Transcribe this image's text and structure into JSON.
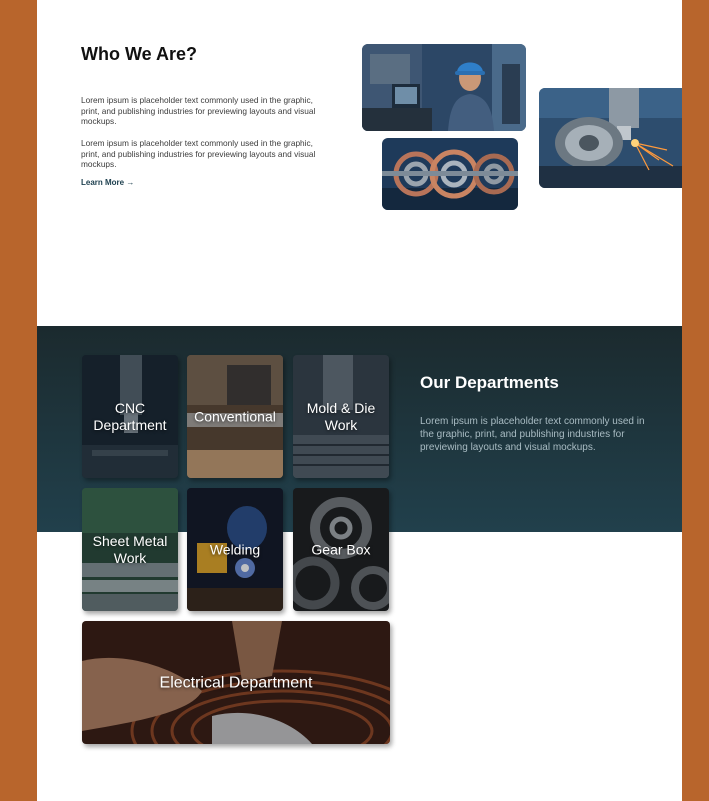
{
  "about": {
    "title": "Who We Are?",
    "paragraph_1": "Lorem ipsum is placeholder text commonly used in the graphic, print, and publishing industries for previewing layouts and visual mockups.",
    "paragraph_2": "Lorem ipsum is placeholder text commonly used in the graphic, print, and publishing industries for previewing layouts and visual mockups.",
    "learn_more": "Learn More →"
  },
  "departments": {
    "title": "Our Departments",
    "description": "Lorem ipsum is placeholder text commonly used in the graphic, print, and publishing industries for previewing layouts and visual mockups.",
    "cards": [
      {
        "label": "CNC Department"
      },
      {
        "label": "Conventional"
      },
      {
        "label": "Mold & Die Work"
      },
      {
        "label": "Sheet Metal Work"
      },
      {
        "label": "Welding"
      },
      {
        "label": "Gear Box"
      },
      {
        "label": "Electrical Department"
      }
    ]
  },
  "colors": {
    "side_accent": "#b8652c",
    "dept_band_top": "#1b2a2e",
    "dept_band_bottom": "#21404c",
    "link": "#1f4150"
  }
}
